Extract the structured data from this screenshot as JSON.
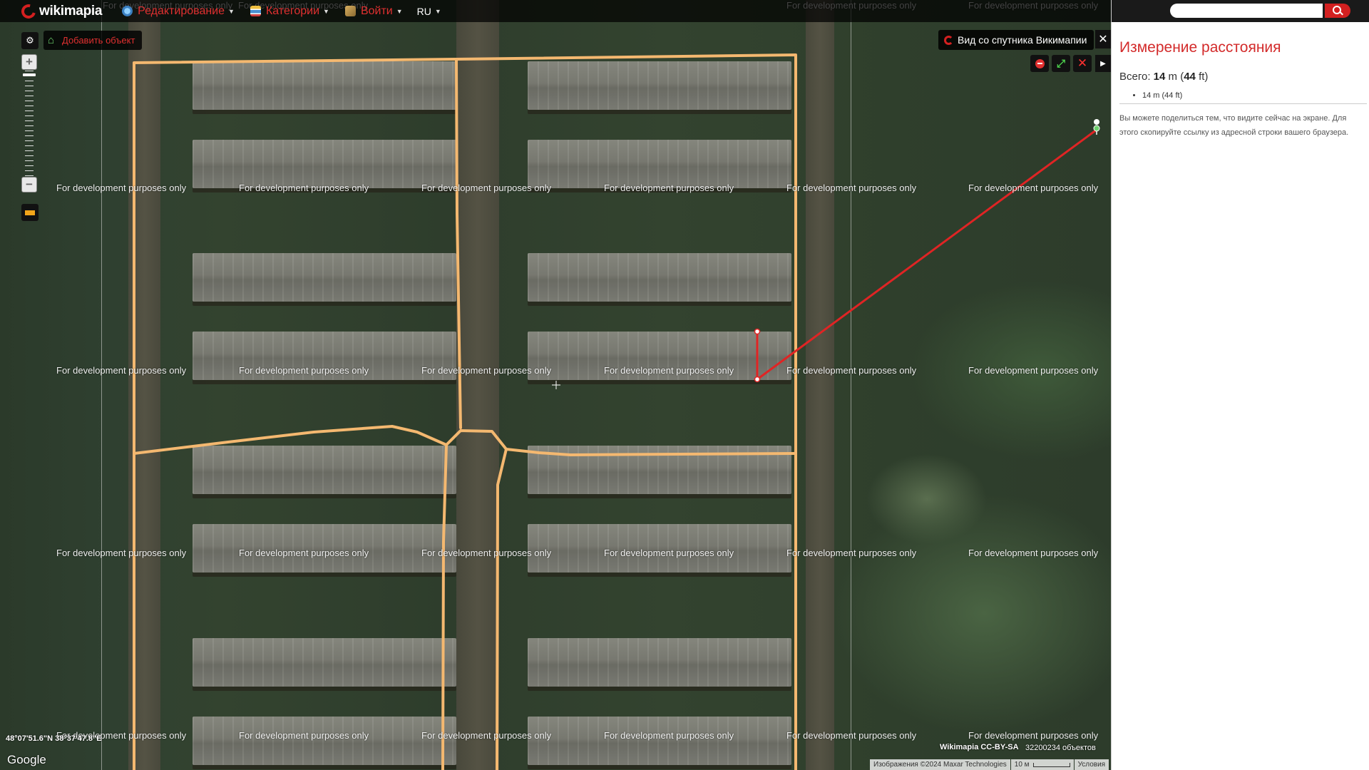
{
  "topbar": {
    "logo_text": "wikimapia",
    "nav": [
      {
        "label": "Редактирование",
        "icon": "globe-edit-icon"
      },
      {
        "label": "Категории",
        "icon": "categories-icon"
      },
      {
        "label": "Войти",
        "icon": "login-icon"
      }
    ],
    "language": "RU"
  },
  "map": {
    "add_object_label": "Добавить объект",
    "satellite_label": "Вид со спутника Викимапии",
    "watermark": "For development purposes only",
    "coordinates": "48°07'51.6\"N 38°37'47.8\"E",
    "google_label": "Google",
    "license": "Wikimapia CC-BY-SA",
    "object_count": "32200234 объектов",
    "imagery": "Изображения ©2024 Maxar Technologies",
    "scale": "10 м",
    "terms": "Условия",
    "colors": {
      "outline": "#f4b870",
      "measure_line": "#e02424",
      "accent": "#d32020"
    }
  },
  "panel": {
    "search_placeholder": "",
    "title": "Измерение расстояния",
    "total_prefix": "Всего:",
    "total_m": "14",
    "unit_m": "m",
    "total_ft": "44",
    "unit_ft": "ft",
    "segment": "14 m (44 ft)",
    "share_text": "Вы можете поделиться тем, что видите сейчас на экране. Для этого скопируйте ссылку из адресной строки вашего браузера."
  }
}
